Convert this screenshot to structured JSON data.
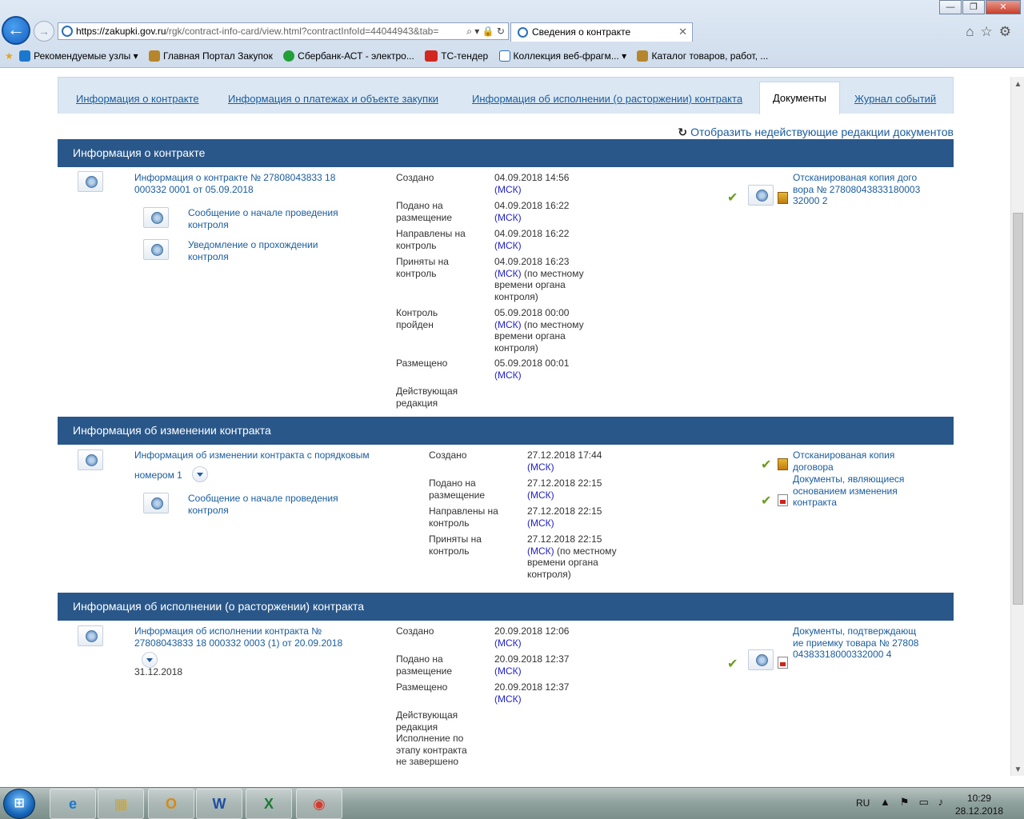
{
  "browser": {
    "url_host": "https://zakupki.gov.ru",
    "url_path": "/rgk/contract-info-card/view.html?contractInfoId=44044943&tab=",
    "tab_title": "Сведения о контракте",
    "tab_close": "✕",
    "window_minimize": "—",
    "window_restore": "❐",
    "window_close": "✕",
    "favorites": [
      {
        "label": "Рекомендуемые узлы ▾"
      },
      {
        "label": "Главная Портал Закупок"
      },
      {
        "label": "Сбербанк-АСТ - электро..."
      },
      {
        "label": "ТС-тендер"
      },
      {
        "label": "Коллекция веб-фрагм... ▾"
      },
      {
        "label": "Каталог товаров, работ, ..."
      }
    ]
  },
  "tabs": [
    {
      "label": "Информация о контракте"
    },
    {
      "label": "Информация о платежах и объекте закупки"
    },
    {
      "label": "Информация об исполнении (о расторжении) контракта"
    },
    {
      "label": "Документы"
    },
    {
      "label": "Журнал событий"
    }
  ],
  "show_revisions": "Отобразить недействующие редакции документов",
  "sections": {
    "contract_info": {
      "title": "Информация о контракте",
      "doc_link": "Информация о контракте № 27808043833 18 000332 0001 от 05.09.2018",
      "sub1": "Сообщение о начале проведения контроля",
      "sub2": "Уведомление о прохождении контроля",
      "rows": [
        {
          "label": "Создано",
          "date": "04.09.2018 14:56",
          "tz": "(МСК)",
          "extra": ""
        },
        {
          "label": "Подано на размещение",
          "date": "04.09.2018 16:22",
          "tz": "(МСК)",
          "extra": ""
        },
        {
          "label": "Направлены на контроль",
          "date": "04.09.2018 16:22",
          "tz": "(МСК)",
          "extra": ""
        },
        {
          "label": "Приняты на контроль",
          "date": "04.09.2018 16:23",
          "tz": "(МСК)",
          "extra": " (по местному времени органа контроля)"
        },
        {
          "label": "Контроль пройден",
          "date": "05.09.2018 00:00",
          "tz": "(МСК)",
          "extra": " (по местному времени органа контроля)"
        },
        {
          "label": "Размещено",
          "date": "05.09.2018 00:01",
          "tz": "(МСК)",
          "extra": ""
        }
      ],
      "status": "Действующая редакция",
      "attachment": "Отсканированая копия договора № 2780804383318000332000 2"
    },
    "change_info": {
      "title": "Информация об изменении контракта",
      "doc_link_a": "Информация об изменении контракта с порядковым",
      "doc_link_b": "номером 1",
      "sub1": "Сообщение о начале проведения контроля",
      "rows": [
        {
          "label": "Создано",
          "date": "27.12.2018 17:44",
          "tz": "(МСК)",
          "extra": ""
        },
        {
          "label": "Подано на размещение",
          "date": "27.12.2018 22:15",
          "tz": "(МСК)",
          "extra": ""
        },
        {
          "label": "Направлены на контроль",
          "date": "27.12.2018 22:15",
          "tz": "(МСК)",
          "extra": ""
        },
        {
          "label": "Приняты на контроль",
          "date": "27.12.2018 22:15",
          "tz": "(МСК)",
          "extra": " (по местному времени органа контроля)"
        }
      ],
      "attachment1": "Отсканированая копия договора",
      "attachment2": "Документы, являющиеся основанием изменения контракта"
    },
    "execution_info": {
      "title": "Информация об исполнении (о расторжении) контракта",
      "doc_link": "Информация об исполнении контракта № 27808043833 18 000332 0003 (1) от 20.09.2018",
      "date_below": "31.12.2018",
      "rows": [
        {
          "label": "Создано",
          "date": "20.09.2018 12:06",
          "tz": "(МСК)",
          "extra": ""
        },
        {
          "label": "Подано на размещение",
          "date": "20.09.2018 12:37",
          "tz": "(МСК)",
          "extra": ""
        },
        {
          "label": "Размещено",
          "date": "20.09.2018 12:37",
          "tz": "(МСК)",
          "extra": ""
        }
      ],
      "status": "Действующая редакция Исполнение по этапу контракта не завершено",
      "attachment": "Документы, подтверждающие приемку товара № 2780804383318000332000 4"
    }
  },
  "taskbar": {
    "start_label": "⊞",
    "apps": [
      {
        "name": "ie",
        "glyph": "e",
        "color": "#1b78d0"
      },
      {
        "name": "explorer",
        "glyph": "▦",
        "color": "#d9a21a"
      },
      {
        "name": "outlook",
        "glyph": "O",
        "color": "#d98a10"
      },
      {
        "name": "word",
        "glyph": "W",
        "color": "#1e4fa3"
      },
      {
        "name": "excel",
        "glyph": "X",
        "color": "#1f7a3a"
      },
      {
        "name": "chrome",
        "glyph": "◉",
        "color": "#d63b2f"
      }
    ],
    "lang": "RU",
    "time": "10:29",
    "date": "28.12.2018"
  }
}
